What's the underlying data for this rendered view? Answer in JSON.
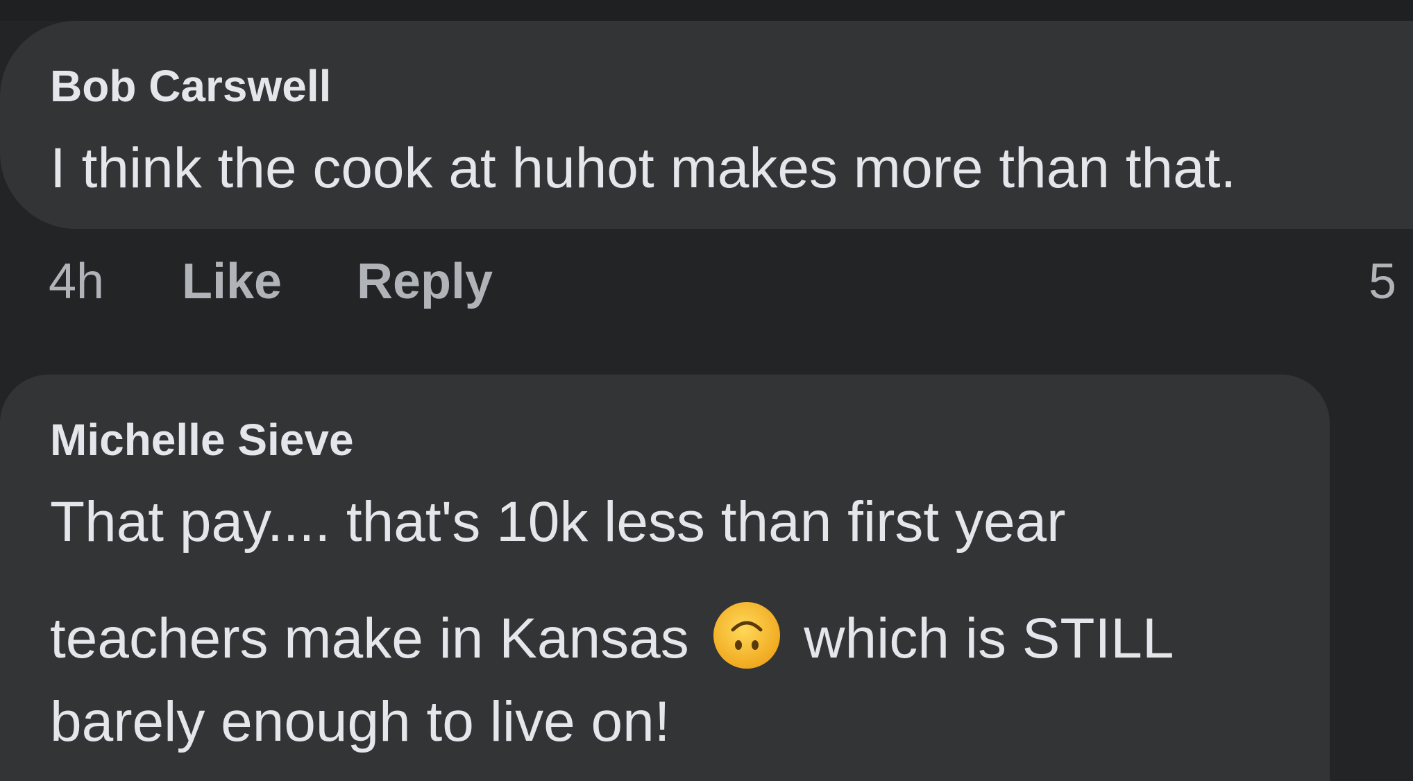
{
  "comments": [
    {
      "author": "Bob Carswell",
      "text": "I think the cook at huhot makes more than that.",
      "time": "4h",
      "like_label": "Like",
      "reply_label": "Reply",
      "reaction_count": "5"
    },
    {
      "author": "Michelle Sieve",
      "lines": [
        "That pay.... that's 10k less than first year",
        "teachers make in Kansas",
        "which is STILL",
        "barely enough to live on!"
      ],
      "emoji": "upside-down-face-emoji"
    }
  ],
  "colors": {
    "background": "#232426",
    "bubble": "#333436",
    "text": "#e4e6eb",
    "meta": "#b0b3b8",
    "emoji": "#f7c23b"
  }
}
